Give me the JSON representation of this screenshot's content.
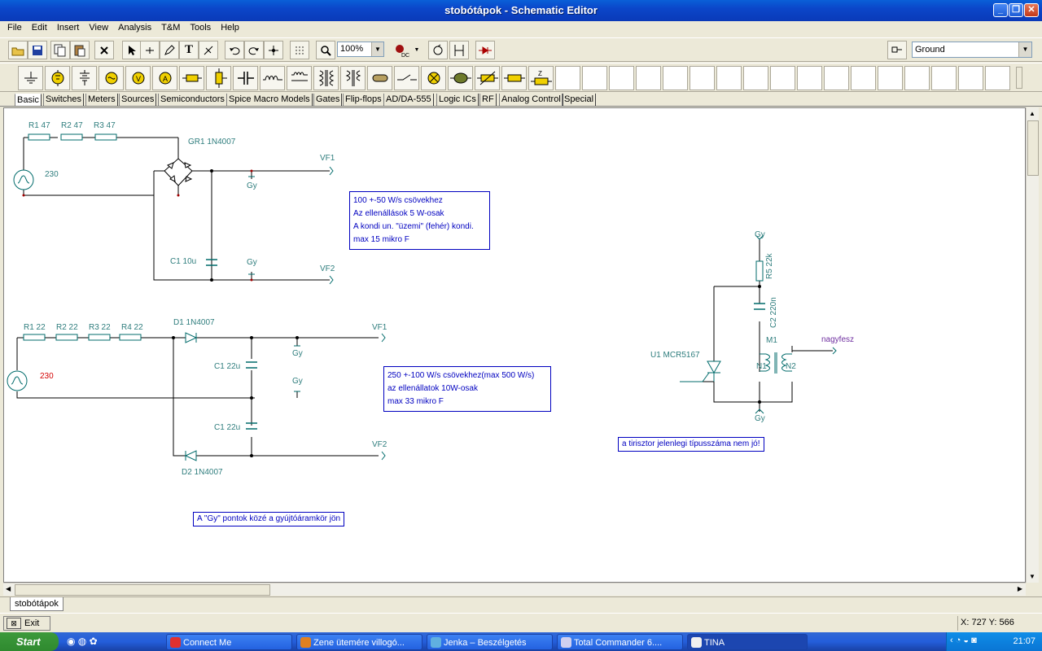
{
  "window": {
    "title": "stobótápok - Schematic Editor"
  },
  "menu": [
    "File",
    "Edit",
    "Insert",
    "View",
    "Analysis",
    "T&M",
    "Tools",
    "Help"
  ],
  "toolbar": {
    "zoom": "100%",
    "ground_select": "Ground"
  },
  "component_tabs": [
    "Basic",
    "Switches",
    "Meters",
    "Sources",
    "Semiconductors",
    "Spice Macro Models",
    "Gates",
    "Flip-flops",
    "AD/DA-555",
    "Logic ICs",
    "RF",
    "Analog Control",
    "Special"
  ],
  "circuit1": {
    "resistors": [
      "R1 47",
      "R2 47",
      "R3 47"
    ],
    "source": "230",
    "bridge": "GR1 1N4007",
    "vf1": "VF1",
    "vf2": "VF2",
    "gy_top": "Gy",
    "gy_bottom": "Gy",
    "cap": "C1 10u"
  },
  "note1": [
    "100 +-50 W/s csövekhez",
    "Az ellenállások 5 W-osak",
    "A kondi un.  \"üzemi\" (fehér) kondi.",
    "max 15 mikro F"
  ],
  "circuit2": {
    "resistors": [
      "R1 22",
      "R2 22",
      "R3 22",
      "R4 22"
    ],
    "source": "230",
    "d1": "D1 1N4007",
    "d2": "D2 1N4007",
    "c_top": "C1 22u",
    "c_bottom": "C1 22u",
    "vf1": "VF1",
    "vf2": "VF2",
    "gy1": "Gy",
    "gy2": "Gy"
  },
  "note2": [
    "250 +-100 W/s csövekhez(max 500 W/s)",
    "az ellenállatok 10W-osak",
    "max 33 mikro F"
  ],
  "note3": "A \"Gy\" pontok közé a gyújtóáramkör jön",
  "circuit3": {
    "gy_top": "Gy",
    "r5": "R5 22k",
    "c2": "C2 220n",
    "m1": "M1",
    "n1": "N1",
    "n2": "N2",
    "u1": "U1 MCR5167",
    "out": "nagyfesz",
    "gy_bottom": "Gy"
  },
  "note4": "a tirisztor jelenlegi típusszáma nem jó!",
  "sheet_tab": "stobótápok",
  "status": {
    "exit": "Exit",
    "coords": "X: 727  Y: 566"
  },
  "taskbar": {
    "start": "Start",
    "tasks": [
      "Connect Me",
      "Zene ütemére villogó...",
      "Jenka – Beszélgetés",
      "Total Commander 6....",
      "TINA"
    ],
    "clock": "21:07"
  },
  "colors": {
    "wire": "#000000",
    "component": "#006b6b",
    "label": "#2e7d7d",
    "note_border": "#0000c0",
    "xp_blue": "#0a46c9"
  }
}
